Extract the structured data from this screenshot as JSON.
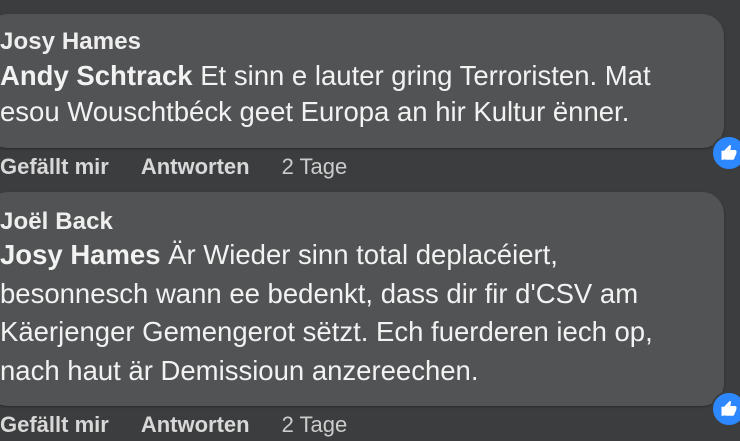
{
  "comments": [
    {
      "author": "Josy Hames",
      "mention": "Andy Schtrack",
      "text": " Et sinn e lauter gring Terroristen. Mat esou Wouschtbéck geet Europa an hir Kultur ënner.",
      "like_label": "Gefällt mir",
      "reply_label": "Antworten",
      "time": "2 Tage",
      "reaction_icon": "thumbs-up-icon"
    },
    {
      "author": "Joël Back",
      "mention": "Josy Hames",
      "text": " Är Wieder sinn total deplacéiert, besonnesch wann ee bedenkt, dass dir fir d'CSV am Käerjenger Gemengerot sëtzt. Ech fuerderen iech op, nach haut är Demissioun anzereechen.",
      "like_label": "Gefällt mir",
      "reply_label": "Antworten",
      "time": "2 Tage",
      "reaction_icon": "thumbs-up-icon"
    }
  ],
  "colors": {
    "background": "#3c3d3e",
    "bubble": "#525354",
    "reaction": "#2d88ff"
  }
}
